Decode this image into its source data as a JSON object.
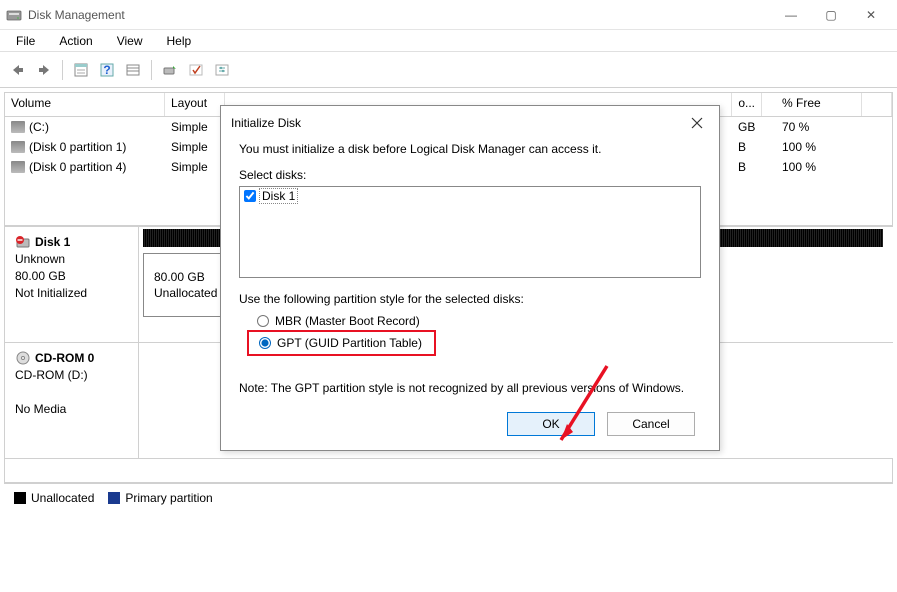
{
  "window": {
    "title": "Disk Management",
    "controls": {
      "minimize": "—",
      "maximize": "▢",
      "close": "✕"
    }
  },
  "menubar": [
    "File",
    "Action",
    "View",
    "Help"
  ],
  "vol_header": {
    "volume": "Volume",
    "layout": "Layout",
    "cap": "o...",
    "free": "% Free"
  },
  "vol_rows": [
    {
      "name": "(C:)",
      "layout": "Simple",
      "cap": "GB",
      "free": "70 %"
    },
    {
      "name": "(Disk 0 partition 1)",
      "layout": "Simple",
      "cap": "B",
      "free": "100 %"
    },
    {
      "name": "(Disk 0 partition 4)",
      "layout": "Simple",
      "cap": "B",
      "free": "100 %"
    }
  ],
  "disks": [
    {
      "icon": "disk-error",
      "title": "Disk 1",
      "line1": "Unknown",
      "line2": "80.00 GB",
      "line3": "Not Initialized",
      "block": {
        "l1": "",
        "l2": "80.00 GB",
        "l3": "Unallocated"
      }
    },
    {
      "icon": "cdrom",
      "title": "CD-ROM 0",
      "line1": "CD-ROM (D:)",
      "line2": "",
      "line3": "No Media"
    }
  ],
  "legend": [
    {
      "label": "Unallocated",
      "color": "#000000"
    },
    {
      "label": "Primary partition",
      "color": "#1a3a8f"
    }
  ],
  "dialog": {
    "title": "Initialize Disk",
    "message": "You must initialize a disk before Logical Disk Manager can access it.",
    "select_label": "Select disks:",
    "disk_item": "Disk 1",
    "style_label": "Use the following partition style for the selected disks:",
    "radio_mbr": "MBR (Master Boot Record)",
    "radio_gpt": "GPT (GUID Partition Table)",
    "note": "Note: The GPT partition style is not recognized by all previous versions of Windows.",
    "ok": "OK",
    "cancel": "Cancel"
  }
}
